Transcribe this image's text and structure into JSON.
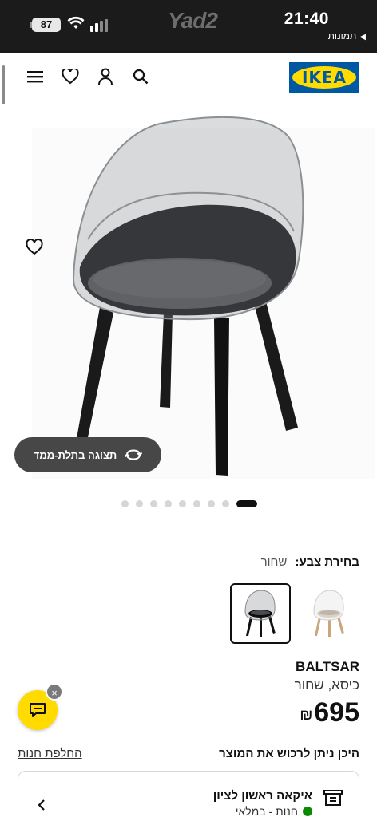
{
  "status_bar": {
    "time": "21:40",
    "back_label": "תמונות",
    "battery": "87",
    "watermark": "Yad2"
  },
  "header": {
    "logo_text": "IKEA"
  },
  "gallery": {
    "view_3d_label": "תצוגה בתלת-ממד",
    "image_count": 9,
    "active_image": 9
  },
  "product": {
    "color_label": "בחירת צבע:",
    "color_value": "שחור",
    "name": "BALTSAR",
    "description": "כיסא, שחור",
    "price": "695",
    "currency": "₪"
  },
  "availability": {
    "where_label": "היכן ניתן לרכוש את המוצר",
    "change_store": "החלפת חנות",
    "store_name": "איקאה ראשון לציון",
    "store_status": "חנות - במלאי",
    "status_color": "#0a8a00"
  },
  "chat": {
    "close_symbol": "×"
  },
  "colors": {
    "brand_blue": "#0058a3",
    "brand_yellow": "#ffdb00"
  }
}
